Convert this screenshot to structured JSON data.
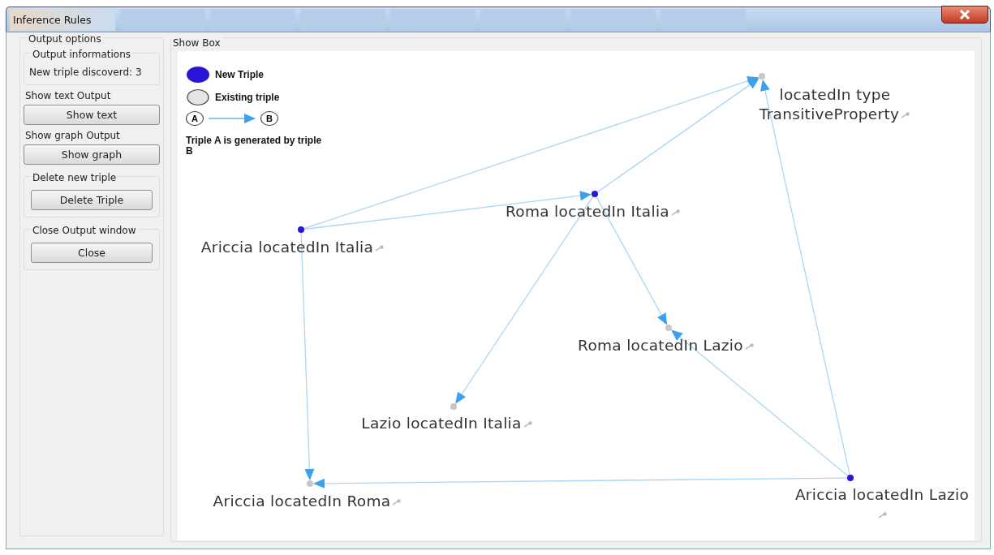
{
  "window": {
    "title": "Inference Rules"
  },
  "output_options": {
    "title": "Output options",
    "info": {
      "title": "Output informations",
      "text": "New triple discoverd: 3"
    },
    "sections": [
      {
        "kind": "plain",
        "label": "Show text Output",
        "button": "Show text"
      },
      {
        "kind": "plain",
        "label": "Show graph Output",
        "button": "Show graph"
      },
      {
        "kind": "group",
        "label": "Delete new triple",
        "button": "Delete Triple"
      },
      {
        "kind": "group",
        "label": "Close Output window",
        "button": "Close"
      }
    ]
  },
  "show_box": {
    "title": "Show Box",
    "legend": {
      "new": "New Triple",
      "existing": "Existing triple",
      "a": "A",
      "b": "B",
      "note": "Triple A is generated by triple B"
    },
    "nodes": [
      {
        "label": "locatedIn type TransitiveProperty",
        "kind": "existing"
      },
      {
        "label": "Roma locatedIn Italia",
        "kind": "new"
      },
      {
        "label": "Ariccia locatedIn Italia",
        "kind": "new"
      },
      {
        "label": "Roma locatedIn Lazio",
        "kind": "existing"
      },
      {
        "label": "Lazio locatedIn Italia",
        "kind": "existing"
      },
      {
        "label": "Ariccia locatedIn Roma",
        "kind": "existing"
      },
      {
        "label": "Ariccia locatedIn Lazio",
        "kind": "new"
      }
    ]
  }
}
